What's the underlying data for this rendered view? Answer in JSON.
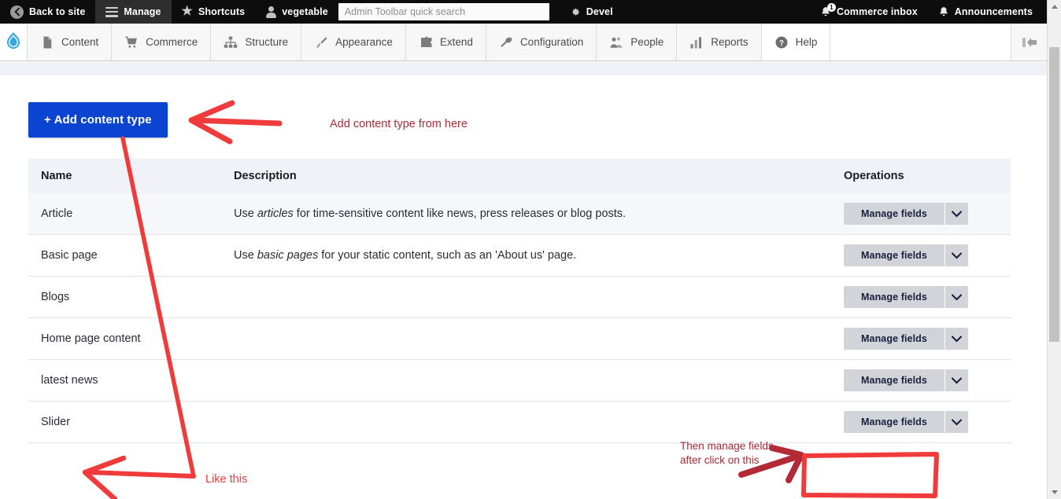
{
  "admin_bar": {
    "back_to_site": "Back to site",
    "manage": "Manage",
    "shortcuts": "Shortcuts",
    "user": "vegetable",
    "search_placeholder": "Admin Toolbar quick search",
    "search_value": "",
    "devel": "Devel",
    "commerce_inbox": "Commerce inbox",
    "commerce_inbox_badge": "1",
    "announcements": "Announcements"
  },
  "menu_bar": {
    "items": [
      {
        "label": "Content",
        "icon": "document-icon"
      },
      {
        "label": "Commerce",
        "icon": "shopping-cart-icon"
      },
      {
        "label": "Structure",
        "icon": "sitemap-icon"
      },
      {
        "label": "Appearance",
        "icon": "paintbrush-icon"
      },
      {
        "label": "Extend",
        "icon": "puzzle-piece-icon"
      },
      {
        "label": "Configuration",
        "icon": "wrench-icon"
      },
      {
        "label": "People",
        "icon": "people-icon"
      },
      {
        "label": "Reports",
        "icon": "bar-chart-icon"
      },
      {
        "label": "Help",
        "icon": "question-mark-icon"
      }
    ],
    "collapse_label": "Collapse toolbar"
  },
  "main": {
    "add_content_type_button": "+ Add content type",
    "table": {
      "headers": {
        "name": "Name",
        "description": "Description",
        "operations": "Operations"
      },
      "rows": [
        {
          "name": "Article",
          "desc_pre": "Use ",
          "desc_em": "articles",
          "desc_post": " for time-sensitive content like news, press releases or blog posts.",
          "operation": "Manage fields"
        },
        {
          "name": "Basic page",
          "desc_pre": "Use ",
          "desc_em": "basic pages",
          "desc_post": " for your static content, such as an 'About us' page.",
          "operation": "Manage fields"
        },
        {
          "name": "Blogs",
          "desc_pre": "",
          "desc_em": "",
          "desc_post": "",
          "operation": "Manage fields"
        },
        {
          "name": "Home page content",
          "desc_pre": "",
          "desc_em": "",
          "desc_post": "",
          "operation": "Manage fields"
        },
        {
          "name": "latest news",
          "desc_pre": "",
          "desc_em": "",
          "desc_post": "",
          "operation": "Manage fields"
        },
        {
          "name": "Slider",
          "desc_pre": "",
          "desc_em": "",
          "desc_post": "",
          "operation": "Manage fields"
        }
      ]
    }
  },
  "annotations": {
    "add_from_here": "Add content type from here",
    "like_this": "Like this",
    "then_manage_line1": "Then manage fields",
    "then_manage_line2": "after click on this"
  },
  "colors": {
    "primary_button": "#0b44d0",
    "annotation_red": "#ef3b3b",
    "annotation_dark_red": "#a82934",
    "toolbar_black": "#0d0d0d",
    "drupal_blue": "#33a9e0"
  }
}
